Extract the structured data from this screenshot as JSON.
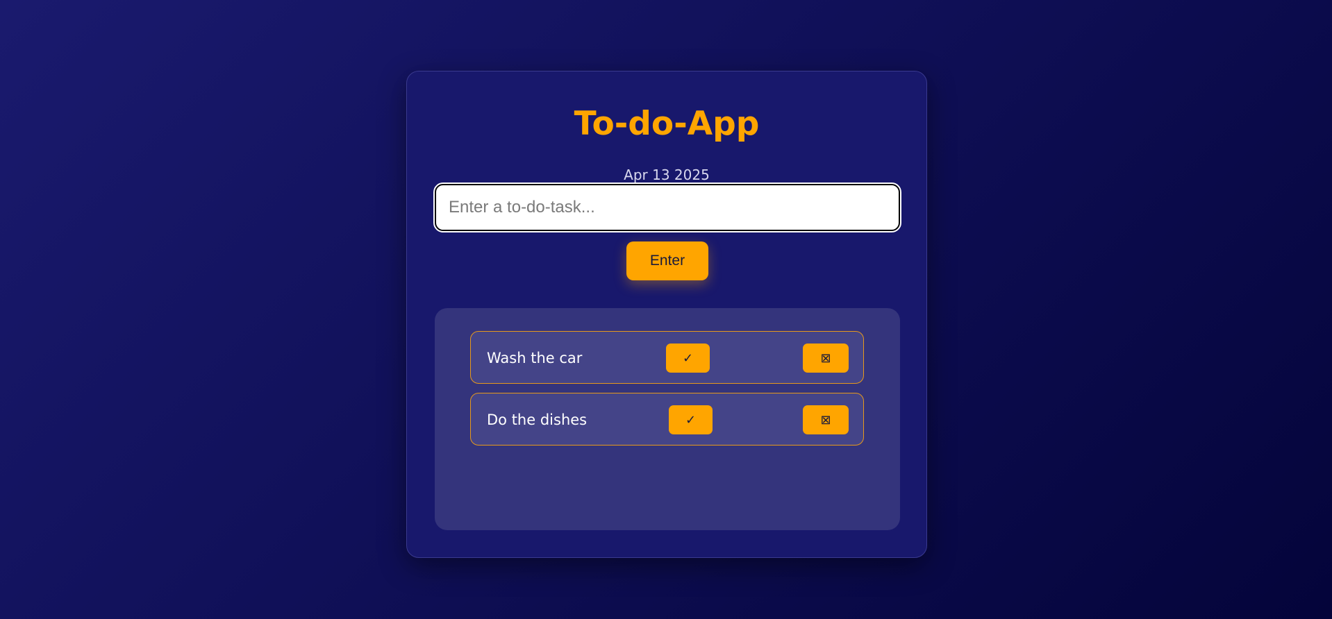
{
  "app": {
    "title": "To-do-App",
    "date": "Apr 13 2025"
  },
  "input": {
    "placeholder": "Enter a to-do-task...",
    "value": ""
  },
  "enter_button": {
    "label": "Enter"
  },
  "tasks": [
    {
      "text": "Wash the car",
      "done_label": "✓",
      "delete_label": "⊠"
    },
    {
      "text": "Do the dishes",
      "done_label": "✓",
      "delete_label": "⊠"
    }
  ],
  "colors": {
    "accent": "#ffa500",
    "card": "#18186c",
    "panel": "#34347c",
    "item": "#444488"
  }
}
